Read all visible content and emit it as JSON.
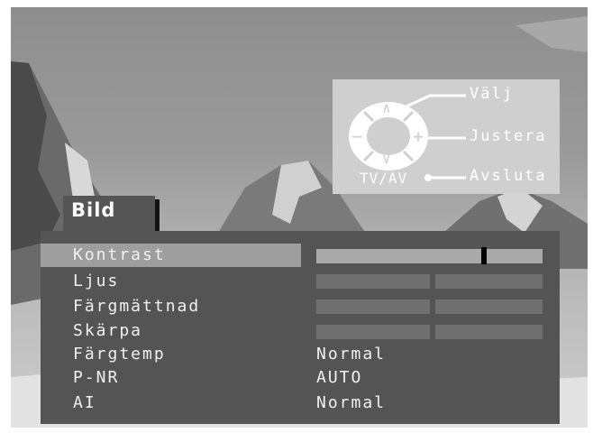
{
  "menu": {
    "title": "Bild",
    "items": [
      {
        "label": "Kontrast",
        "kind": "slider",
        "level": 0.74,
        "selected": true
      },
      {
        "label": "Ljus",
        "kind": "slider-split"
      },
      {
        "label": "Färgmättnad",
        "kind": "slider-split"
      },
      {
        "label": "Skärpa",
        "kind": "slider-split"
      },
      {
        "label": "Färgtemp",
        "kind": "value",
        "value": "Normal"
      },
      {
        "label": "P-NR",
        "kind": "value",
        "value": "AUTO"
      },
      {
        "label": "AI",
        "kind": "value",
        "value": "Normal"
      }
    ]
  },
  "guide": {
    "select_label": "Välj",
    "adjust_label": "Justera",
    "exit_label": "Avsluta",
    "tvav_label": "TV/AV",
    "up_symbol": "∧",
    "down_symbol": "∨",
    "minus_symbol": "−",
    "plus_symbol": "+"
  },
  "colors": {
    "panel": "#545454",
    "selection": "#9e9e9e",
    "guide_background": "#cfcfcf",
    "text": "#f0f0f0"
  }
}
